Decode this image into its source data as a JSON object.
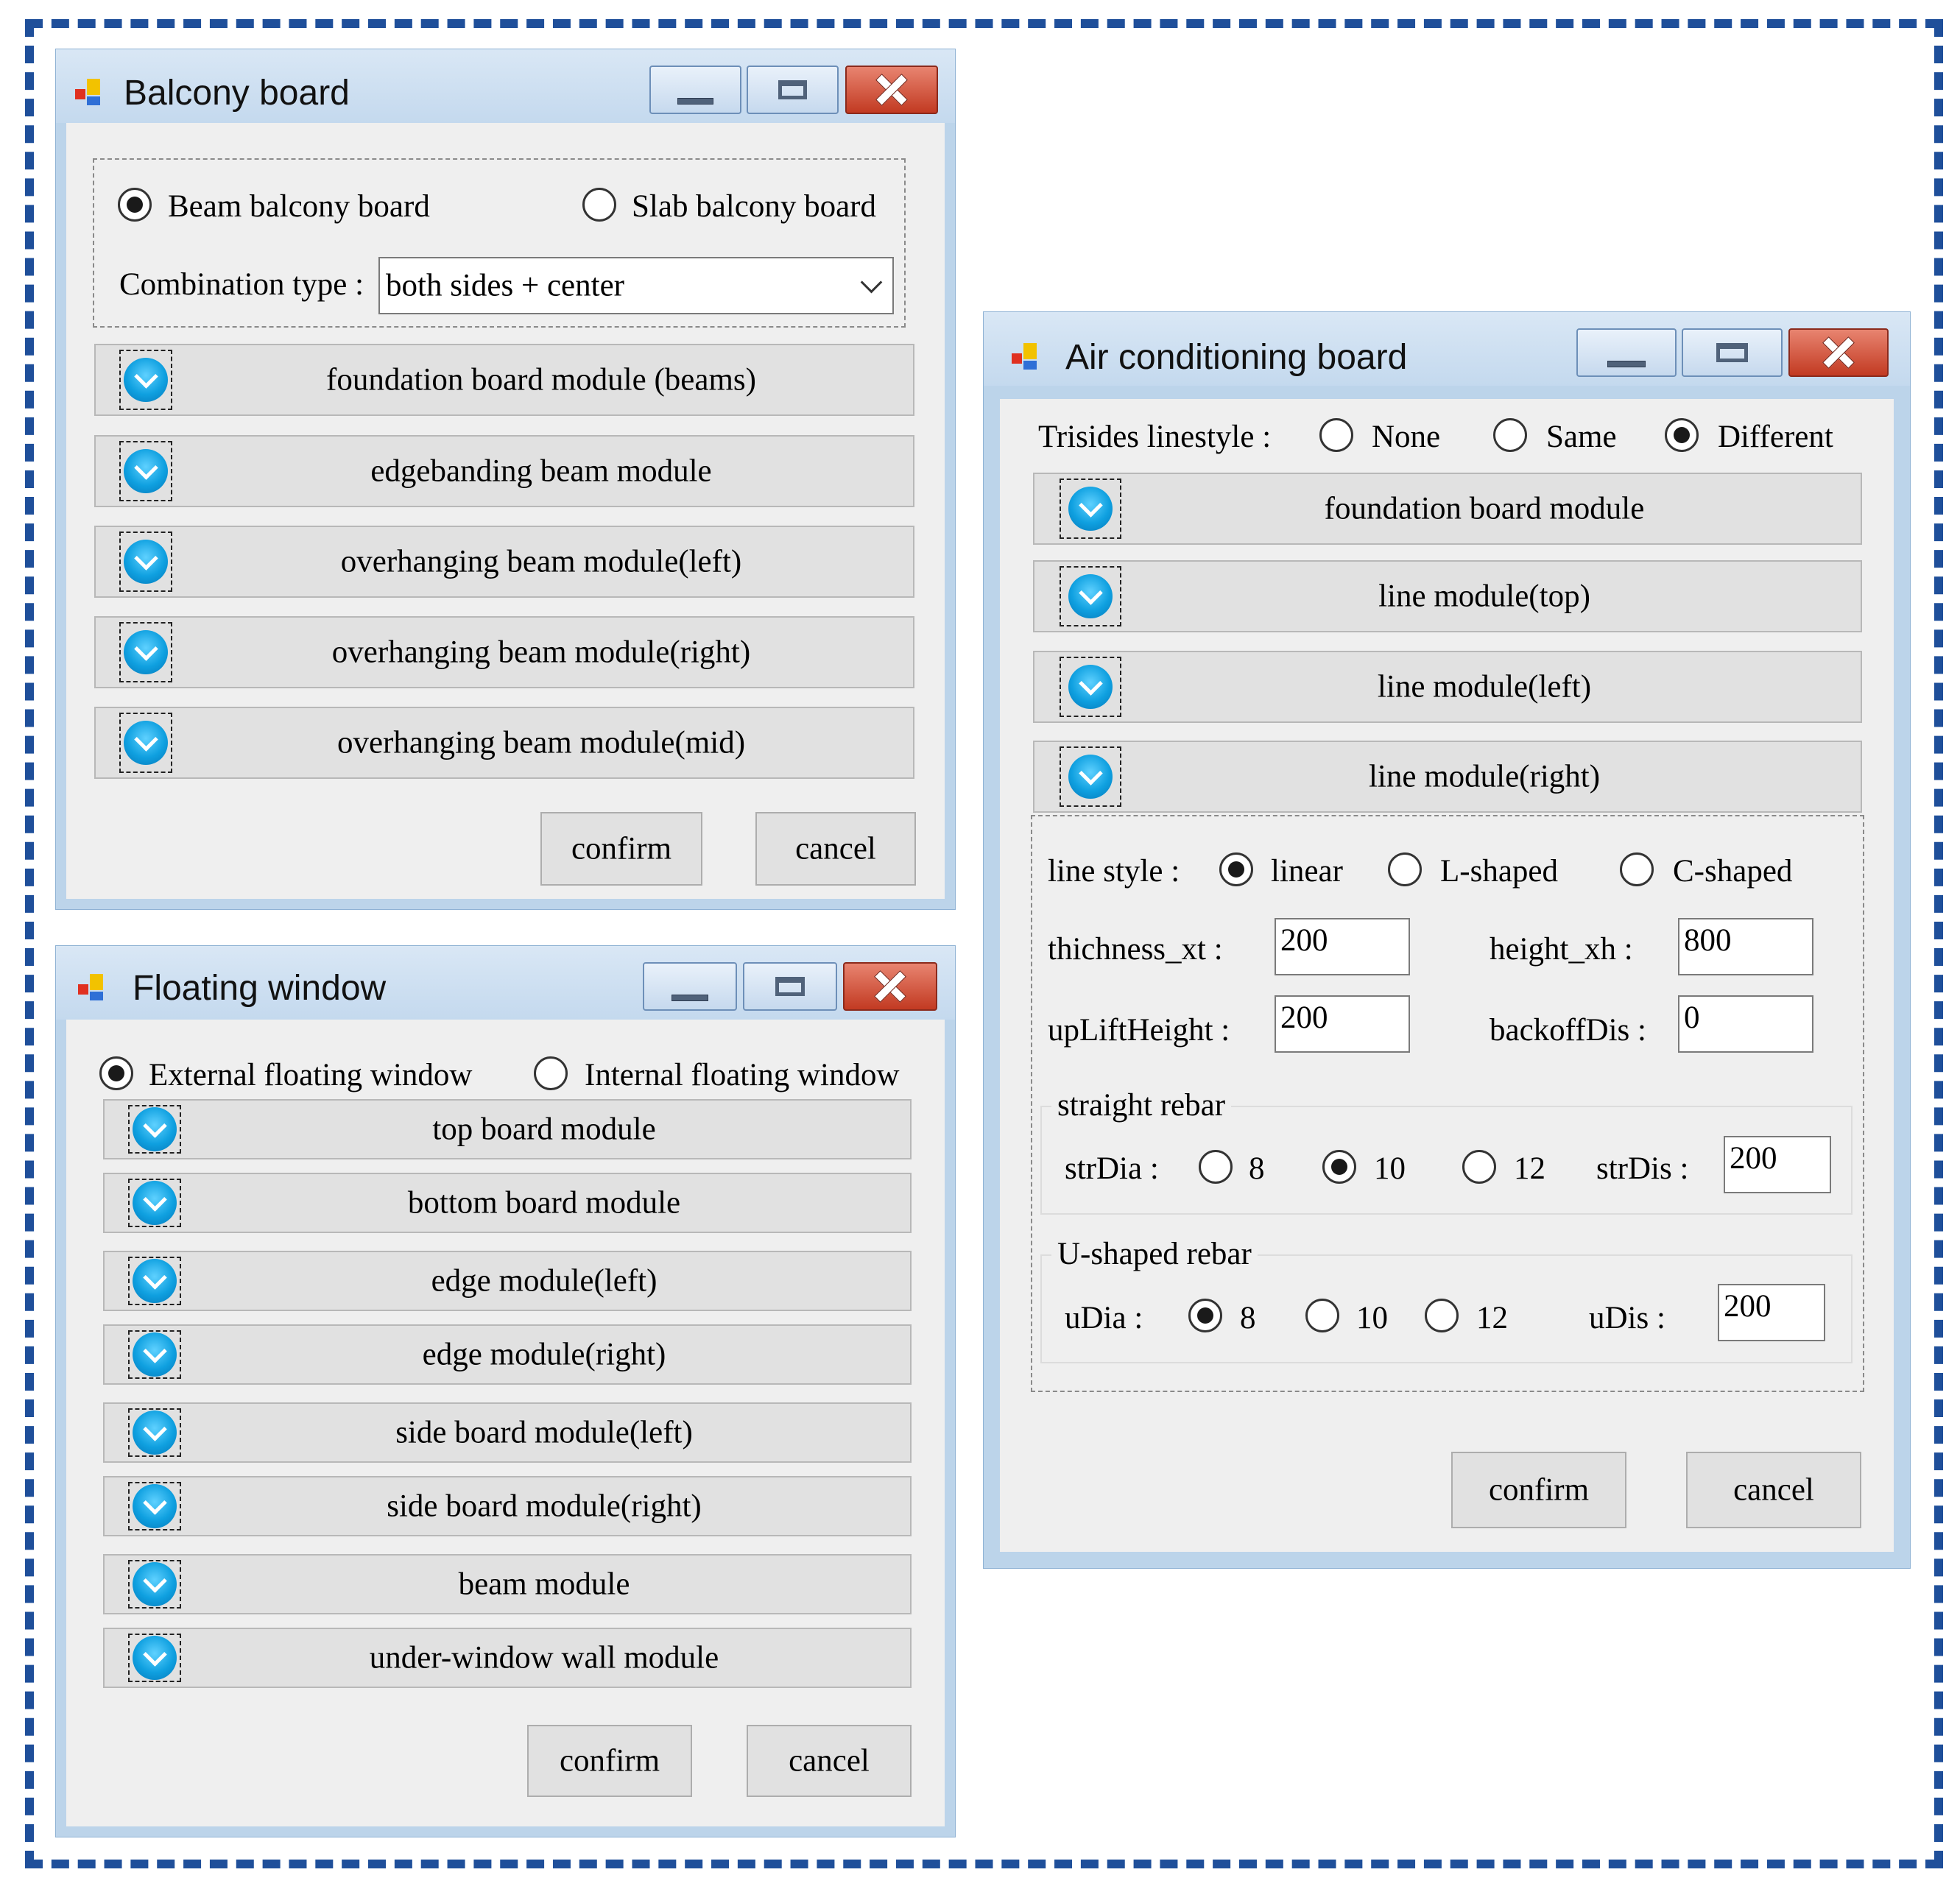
{
  "balcony": {
    "title": "Balcony board",
    "radio_beam": "Beam balcony board",
    "radio_slab": "Slab balcony board",
    "selected_type": "beam",
    "combination_label": "Combination type :",
    "combination_value": "both sides + center",
    "modules": [
      "foundation board module (beams)",
      "edgebanding beam module",
      "overhanging beam module(left)",
      "overhanging beam module(right)",
      "overhanging beam module(mid)"
    ],
    "confirm": "confirm",
    "cancel": "cancel"
  },
  "floating": {
    "title": "Floating window",
    "radio_external": "External floating window",
    "radio_internal": "Internal floating window",
    "selected_type": "external",
    "modules": [
      "top board module",
      "bottom board module",
      "edge module(left)",
      "edge module(right)",
      "side board module(left)",
      "side board module(right)",
      "beam module",
      "under-window wall module"
    ],
    "confirm": "confirm",
    "cancel": "cancel"
  },
  "aircon": {
    "title": "Air conditioning board",
    "trisides_label": "Trisides linestyle :",
    "trisides_options": [
      "None",
      "Same",
      "Different"
    ],
    "trisides_selected": "Different",
    "modules": [
      "foundation board module",
      "line module(top)",
      "line module(left)",
      "line module(right)"
    ],
    "line_style_label": "line style :",
    "line_style_options": [
      "linear",
      "L-shaped",
      "C-shaped"
    ],
    "line_style_selected": "linear",
    "thickness_label": "thichness_xt :",
    "thickness_value": "200",
    "height_label": "height_xh :",
    "height_value": "800",
    "uplift_label": "upLiftHeight :",
    "uplift_value": "200",
    "backoff_label": "backoffDis :",
    "backoff_value": "0",
    "straight_group": "straight rebar",
    "str_dia_label": "strDia :",
    "str_dia_options": [
      "8",
      "10",
      "12"
    ],
    "str_dia_selected": "10",
    "str_dis_label": "strDis :",
    "str_dis_value": "200",
    "u_group": "U-shaped rebar",
    "u_dia_label": "uDia :",
    "u_dia_options": [
      "8",
      "10",
      "12"
    ],
    "u_dia_selected": "8",
    "u_dis_label": "uDis :",
    "u_dis_value": "200",
    "confirm": "confirm",
    "cancel": "cancel"
  },
  "colors": {
    "frame_dash": "#1f4f9a",
    "window_frame": "#bcd4ea",
    "client_bg": "#efefef",
    "close_button": "#c23a22",
    "module_icon": "#0fa0e0"
  },
  "icons": {
    "app": "app-icon",
    "module": "chevron-down-circle-icon"
  }
}
